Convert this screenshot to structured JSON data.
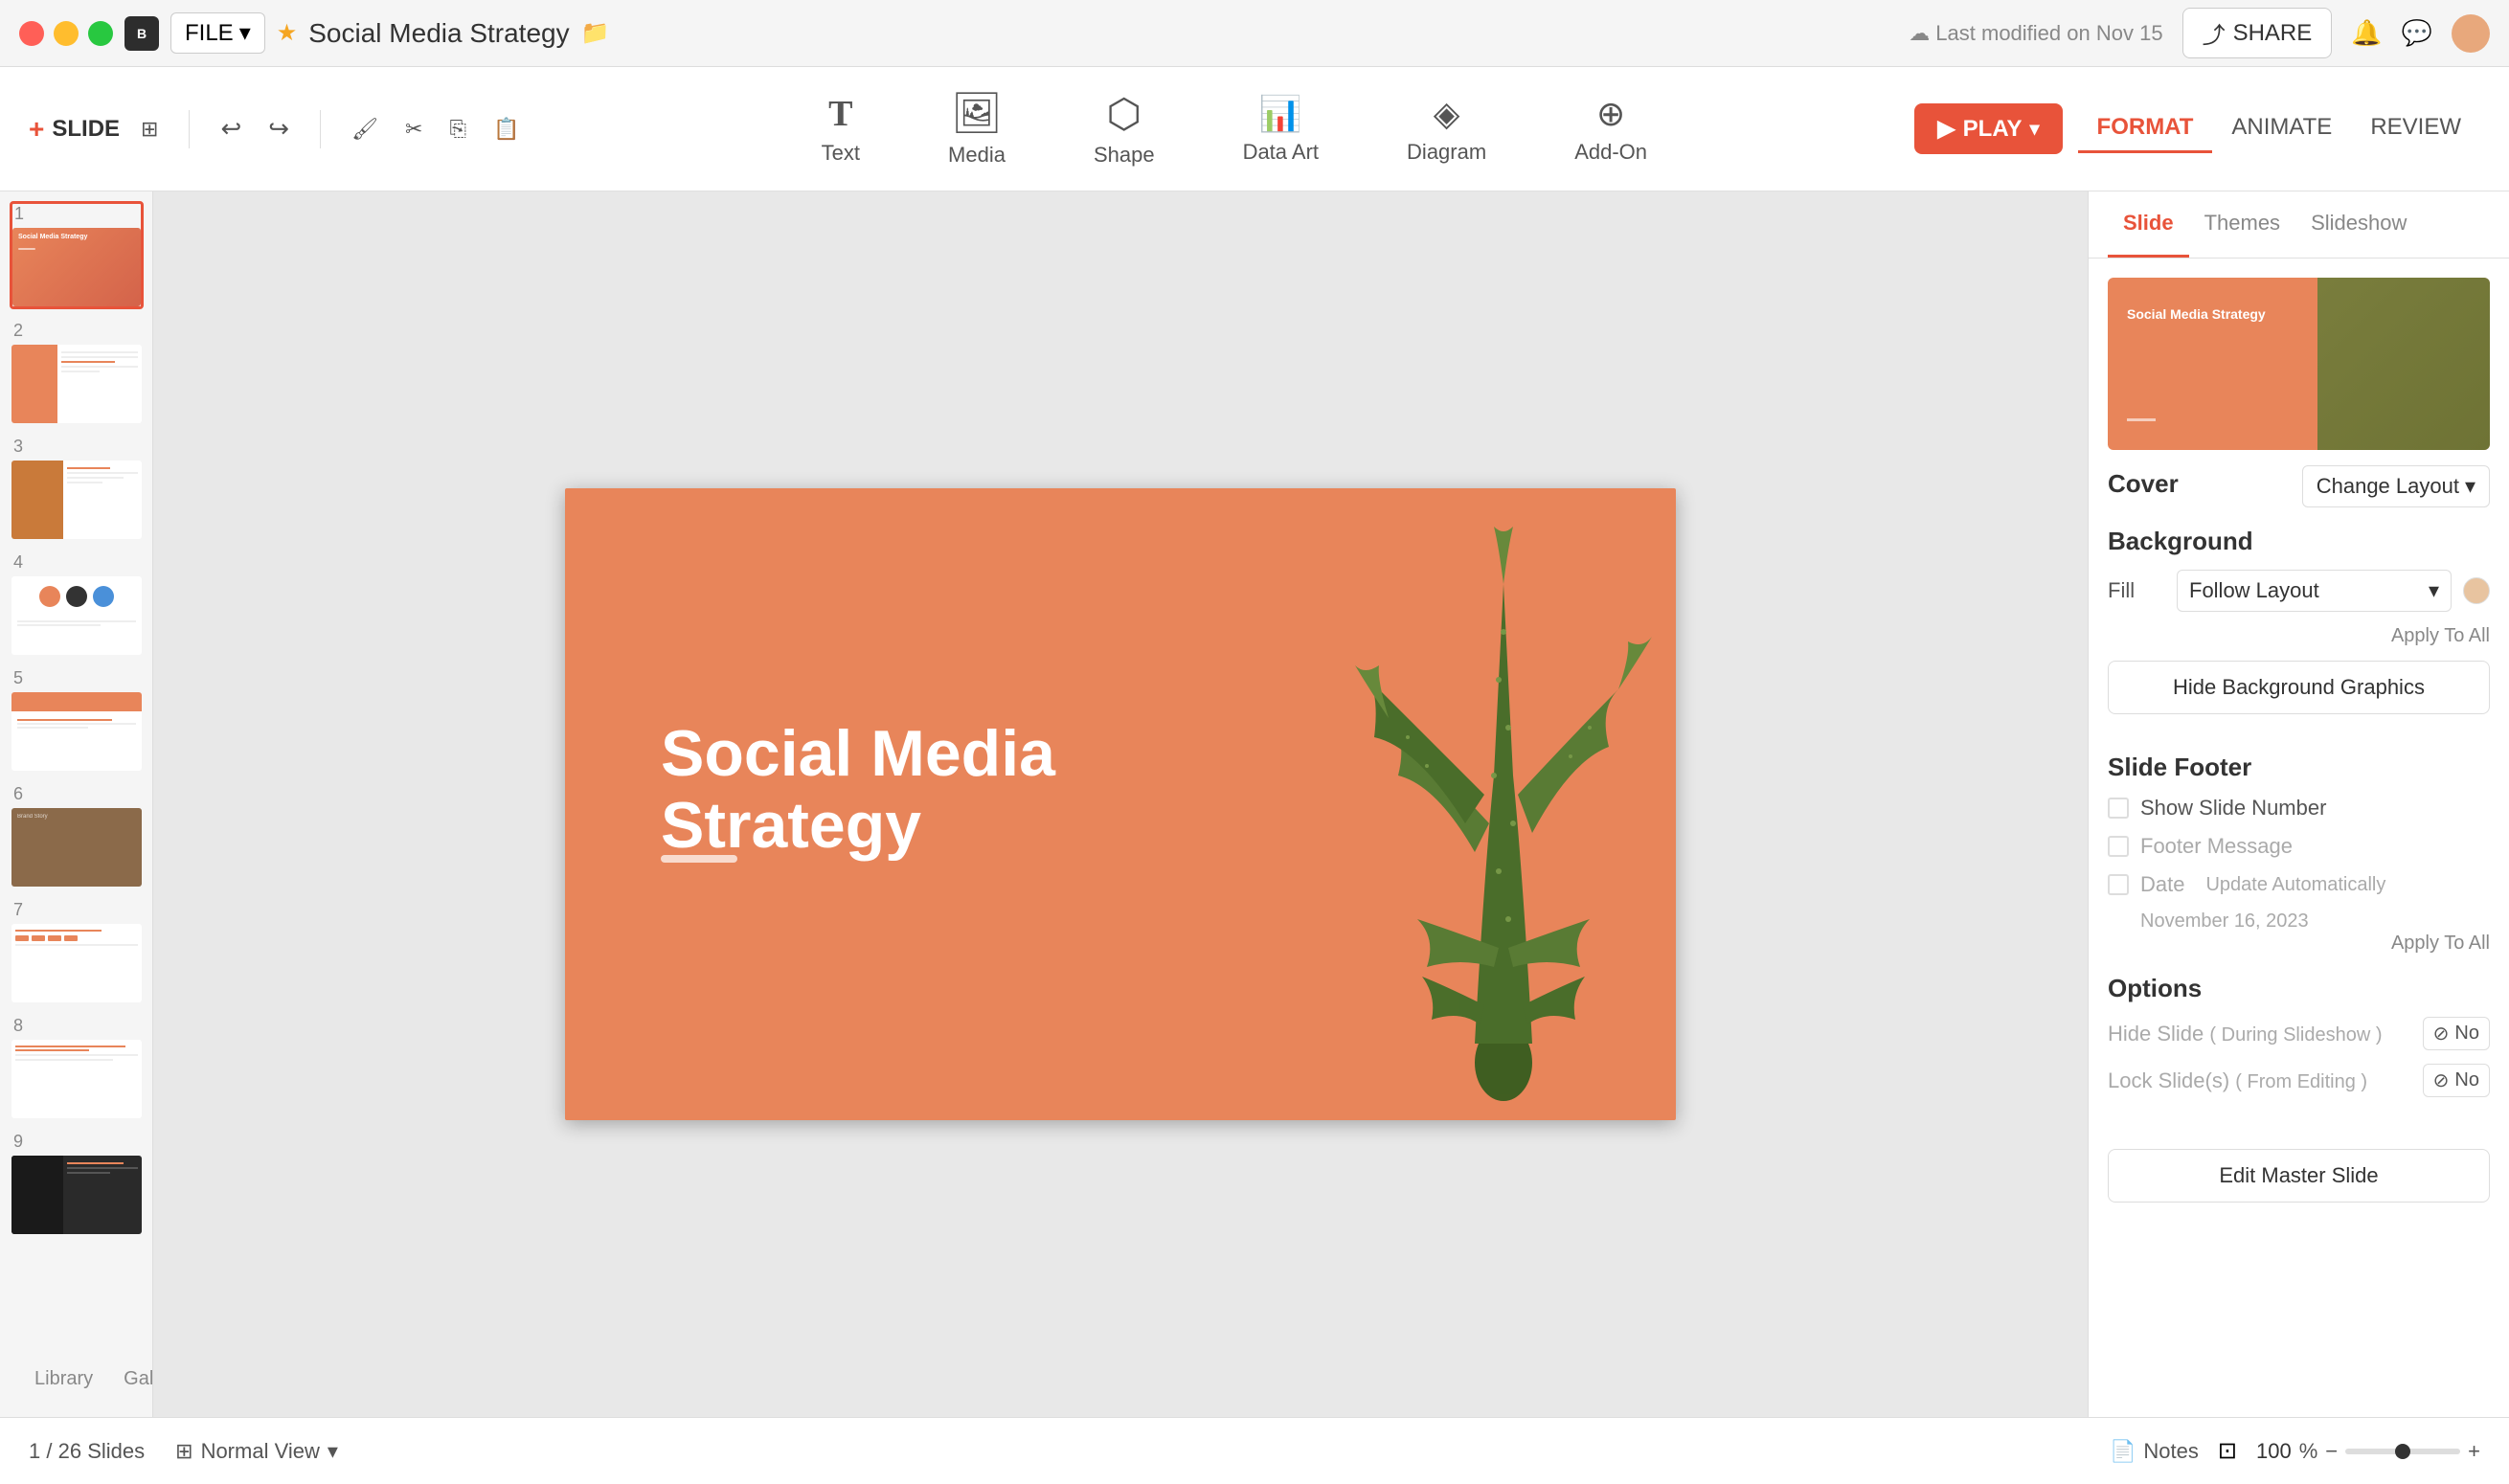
{
  "app": {
    "traffic_lights": [
      "red",
      "yellow",
      "green"
    ],
    "file_label": "FILE",
    "star": "★",
    "title": "Social Media Strategy",
    "folder_icon": "📁",
    "last_modified": "Last modified on Nov 15",
    "share_label": "SHARE"
  },
  "toolbar": {
    "slide_label": "SLIDE",
    "tools": [
      {
        "icon": "T",
        "label": "Text",
        "type": "text"
      },
      {
        "icon": "🖼",
        "label": "Media",
        "type": "media"
      },
      {
        "icon": "⬡",
        "label": "Shape",
        "type": "shape"
      },
      {
        "icon": "📊",
        "label": "Data Art",
        "type": "dataart"
      },
      {
        "icon": "◈",
        "label": "Diagram",
        "type": "diagram"
      },
      {
        "icon": "⊕",
        "label": "Add-On",
        "type": "addon"
      }
    ],
    "play_label": "PLAY",
    "format_label": "FORMAT",
    "animate_label": "ANIMATE",
    "review_label": "REVIEW"
  },
  "slides": [
    {
      "number": "1",
      "type": "cover"
    },
    {
      "number": "2",
      "type": "toc"
    },
    {
      "number": "3",
      "type": "person"
    },
    {
      "number": "4",
      "type": "circles"
    },
    {
      "number": "5",
      "type": "brand"
    },
    {
      "number": "6",
      "type": "photo"
    },
    {
      "number": "7",
      "type": "strategy"
    },
    {
      "number": "8",
      "type": "content"
    },
    {
      "number": "9",
      "type": "dark"
    }
  ],
  "main_slide": {
    "title": "Social Media Strategy",
    "bar_visible": true
  },
  "panel": {
    "tabs": [
      {
        "label": "Slide",
        "active": true
      },
      {
        "label": "Themes",
        "active": false
      },
      {
        "label": "Slideshow",
        "active": false
      }
    ],
    "cover_label": "Cover",
    "change_layout": "Change Layout",
    "background_section": "Background",
    "fill_label": "Fill",
    "fill_value": "Follow Layout",
    "apply_all_label": "Apply To All",
    "hide_bg_label": "Hide Background Graphics",
    "footer_section": "Slide Footer",
    "show_slide_number": "Show Slide Number",
    "footer_message": "Footer Message",
    "date_label": "Date",
    "update_auto": "Update Automatically",
    "date_value": "November 16, 2023",
    "apply_all_footer": "Apply To All",
    "options_section": "Options",
    "hide_slide_label": "Hide Slide",
    "hide_slide_sub": "( During Slideshow )",
    "hide_slide_value": "No",
    "lock_slides_label": "Lock Slide(s)",
    "lock_slides_sub": "( From Editing )",
    "lock_slides_value": "No",
    "edit_master_label": "Edit Master Slide"
  },
  "bottom": {
    "page": "1",
    "total": "26 Slides",
    "view_label": "Normal View",
    "notes_label": "Notes",
    "zoom_value": "100",
    "zoom_symbol": "%"
  },
  "library": {
    "lib_label": "Library",
    "gallery_label": "Gallery"
  }
}
